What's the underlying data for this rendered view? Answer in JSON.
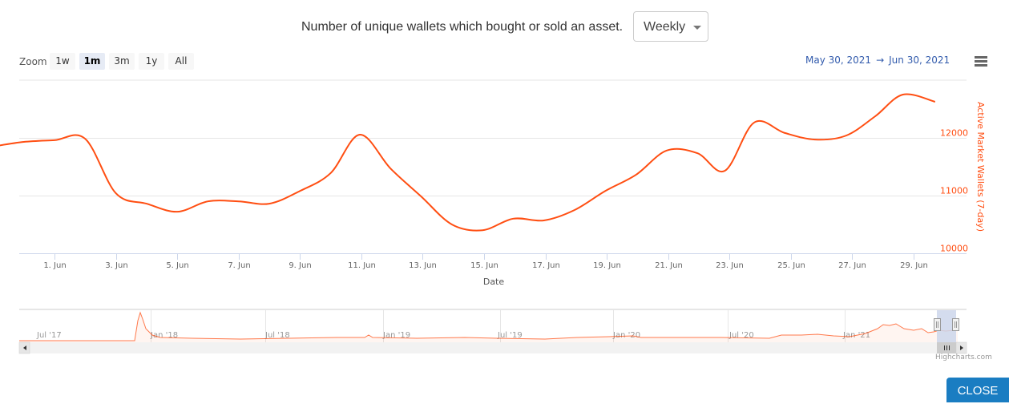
{
  "header": {
    "title": "Number of unique wallets which bought or sold an asset.",
    "period_select": {
      "value": "Weekly"
    }
  },
  "range_selector": {
    "zoom_label": "Zoom",
    "buttons": [
      {
        "label": "1w",
        "active": false
      },
      {
        "label": "1m",
        "active": true
      },
      {
        "label": "3m",
        "active": false
      },
      {
        "label": "1y",
        "active": false
      },
      {
        "label": "All",
        "active": false
      }
    ],
    "from": "May 30, 2021",
    "arrow": "→",
    "to": "Jun 30, 2021"
  },
  "menu": {
    "icon": "hamburger-menu-icon"
  },
  "colors": {
    "series": "#ff4e12",
    "axis_label": "#ff4e12",
    "grid": "#e6e6e6",
    "navigator_mask": "#ccd6eb",
    "close_button": "#1a7dc2"
  },
  "chart_data": {
    "type": "line",
    "title": "Number of unique wallets which bought or sold an asset.",
    "xlabel": "Date",
    "ylabel": "Active Market Wallets (7-day)",
    "y_axis_side": "right",
    "ylim": [
      10000,
      13000
    ],
    "yticks": [
      10000,
      11000,
      12000
    ],
    "ytick_labels": [
      "10000",
      "11000",
      "12000"
    ],
    "xlim_days": [
      30,
      60.9
    ],
    "xticks_day": [
      32,
      34,
      36,
      38,
      40,
      42,
      44,
      46,
      48,
      50,
      52,
      54,
      56,
      58,
      60
    ],
    "xtick_labels": [
      "1. Jun",
      "3. Jun",
      "5. Jun",
      "7. Jun",
      "9. Jun",
      "11. Jun",
      "13. Jun",
      "15. Jun",
      "17. Jun",
      "19. Jun",
      "21. Jun",
      "23. Jun",
      "25. Jun",
      "27. Jun",
      "29. Jun"
    ],
    "grid": true,
    "legend": "none",
    "series": [
      {
        "name": "Active Market Wallets (7-day)",
        "x_day": [
          30.0,
          31.0,
          32.0,
          33.0,
          34.0,
          35.0,
          36.0,
          37.0,
          38.0,
          39.0,
          40.0,
          41.0,
          41.95,
          42.95,
          43.95,
          44.95,
          45.95,
          46.95,
          47.95,
          48.95,
          49.95,
          50.95,
          51.95,
          52.95,
          53.85,
          54.8,
          55.8,
          56.8,
          57.8,
          58.75,
          59.65,
          60.7
        ],
        "values": [
          11850,
          11930,
          11960,
          11985,
          11040,
          10860,
          10720,
          10900,
          10900,
          10860,
          11080,
          11390,
          12055,
          11470,
          10985,
          10500,
          10400,
          10600,
          10570,
          10750,
          11080,
          11360,
          11780,
          11735,
          11430,
          12265,
          12085,
          11970,
          12040,
          12375,
          12750,
          12625
        ]
      }
    ],
    "navigator": {
      "xtick_labels": [
        "Jul '17",
        "Jan '18",
        "Jul '18",
        "Jan '19",
        "Jul '19",
        "Jan '20",
        "Jul '20",
        "Jan '21"
      ],
      "selected_range": [
        "May 30, 2021",
        "Jun 30, 2021"
      ]
    }
  },
  "credits": "Highcharts.com",
  "close_button": {
    "label": "CLOSE"
  }
}
